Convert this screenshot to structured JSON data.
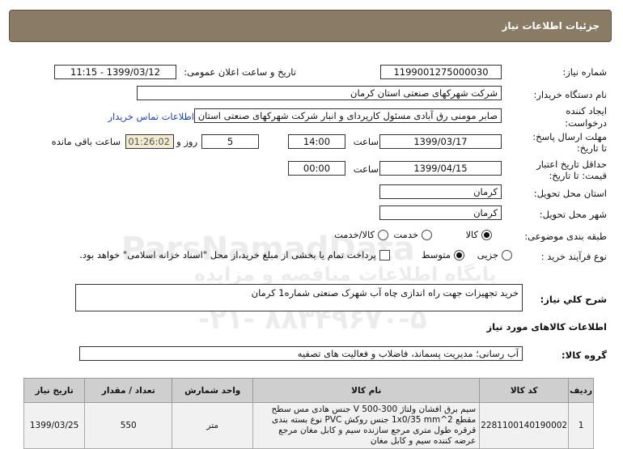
{
  "header": {
    "title": "جزئیات اطلاعات نیاز"
  },
  "form": {
    "need_number_label": "شماره نیاز:",
    "need_number": "1199001275000030",
    "announce_datetime_label": "تاریخ و ساعت اعلان عمومی:",
    "announce_datetime": "1399/03/12 - 11:15",
    "buyer_org_label": "نام دستگاه خریدار:",
    "buyer_org": "شرکت شهرکهای صنعتی استان کرمان",
    "requester_label": "ایجاد کننده درخواست:",
    "requester": "صابر مومنی رق آبادی مسئول کارپردای و انبار شرکت شهرکهای صنعتی استان کرمان",
    "buyer_contact_link": "اطلاعات تماس خریدار",
    "reply_deadline_label": "مهلت ارسال پاسخ: تا تاریخ:",
    "reply_date": "1399/03/17",
    "time_label": "ساعت",
    "reply_time": "14:00",
    "days_value": "5",
    "days_label": "روز و",
    "remaining_time": "01:26:02",
    "remaining_label": "ساعت باقی مانده",
    "price_validity_label": "حداقل تاریخ اعتبار قیمت: تا تاریخ:",
    "validity_date": "1399/04/15",
    "validity_time": "00:00",
    "delivery_province_label": "استان محل تحویل:",
    "delivery_province": "کرمان",
    "delivery_city_label": "شهر محل تحویل:",
    "delivery_city": "کرمان",
    "category_label": "طبقه بندی موضوعی:",
    "category_options": [
      "کالا",
      "خدمت",
      "کالا/خدمت"
    ],
    "category_selected": "کالا",
    "purchase_type_label": "نوع فرآیند خرید :",
    "purchase_options": [
      "جزیی",
      "متوسط"
    ],
    "purchase_selected": "متوسط",
    "treasury_note": "پرداخت تمام یا بخشی از مبلغ خرید،از محل \"اسناد خزانه اسلامی\" خواهد بود."
  },
  "summary": {
    "label": "شرح كلي نياز:",
    "text": "خرید تجهیزات جهت راه اندازی چاه آب شهرک صنعتی شماره1 کرمان"
  },
  "goods_section": {
    "title": "اطلاعات کالاهای مورد نیاز",
    "group_label": "گروه کالا:",
    "group_value": "آب رسانی؛ مدیریت پسماند، فاضلاب و فعالیت های تصفیه"
  },
  "table": {
    "headers": [
      "ردیف",
      "کد کالا",
      "نام کالا",
      "واحد شمارش",
      "تعداد / مقدار",
      "تاریخ نیاز"
    ],
    "rows": [
      {
        "index": "1",
        "code": "2281100140190002",
        "name": "سیم برق افشان ولتاژ 300-500 V جنس هادی مس سطح مقطع 1x0/35 mm^2 جنس روکش PVC نوع بسته بندی قرقره طول متری مرجع سازنده سیم و کابل مغان مرجع عرضه کننده سیم و کابل مغان",
        "unit": "متر",
        "quantity": "550",
        "date": "1399/03/25"
      }
    ]
  },
  "watermark": {
    "line1": "ParsNamadData",
    "line2": "پایگاه اطلاعات مناقصه و مزایده",
    "line3": "-۲۱- ۸۸۳۴۹۶۷۰-۵"
  }
}
